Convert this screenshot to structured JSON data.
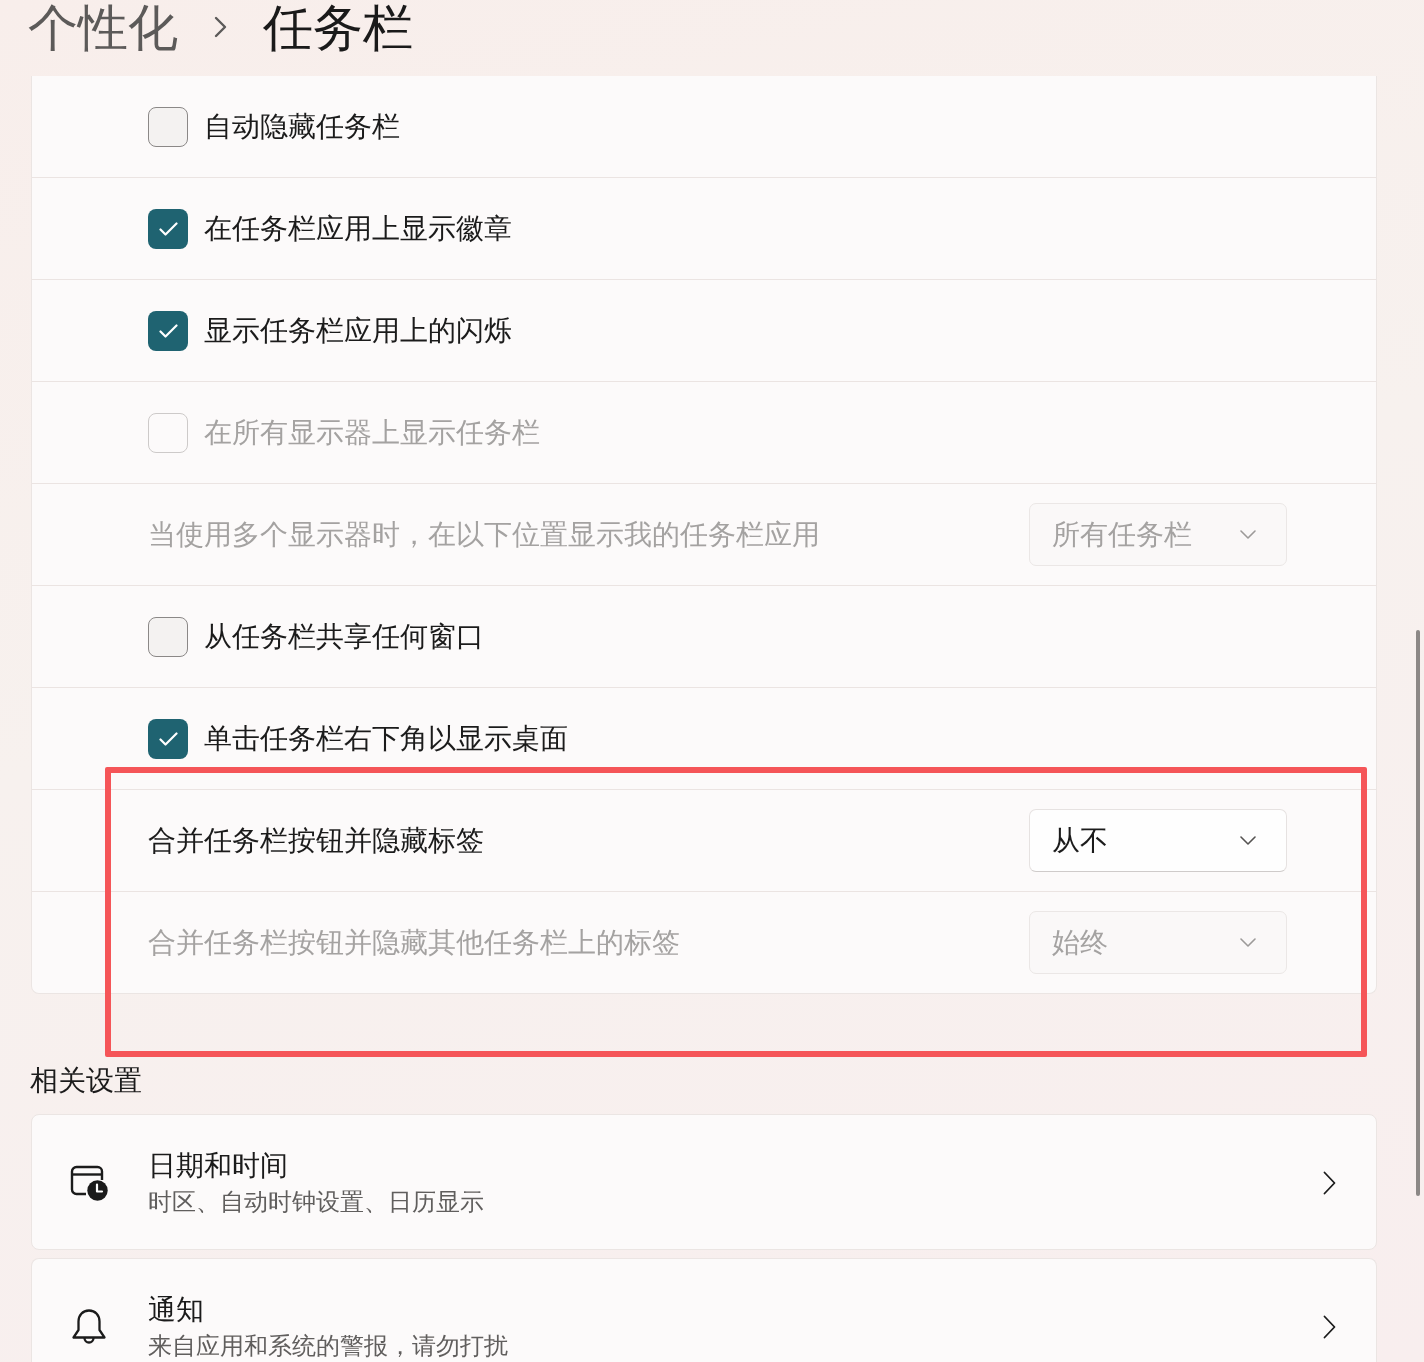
{
  "breadcrumb": {
    "parent": "个性化",
    "current": "任务栏"
  },
  "taskbar_behaviors": {
    "rows": [
      {
        "kind": "checkbox",
        "label": "自动隐藏任务栏",
        "checked": false,
        "disabled": false
      },
      {
        "kind": "checkbox",
        "label": "在任务栏应用上显示徽章",
        "checked": true,
        "disabled": false
      },
      {
        "kind": "checkbox",
        "label": "显示任务栏应用上的闪烁",
        "checked": true,
        "disabled": false
      },
      {
        "kind": "checkbox",
        "label": "在所有显示器上显示任务栏",
        "checked": false,
        "disabled": true
      },
      {
        "kind": "dropdown",
        "label": "当使用多个显示器时，在以下位置显示我的任务栏应用",
        "value": "所有任务栏",
        "disabled": true
      },
      {
        "kind": "checkbox",
        "label": "从任务栏共享任何窗口",
        "checked": false,
        "disabled": false
      },
      {
        "kind": "checkbox",
        "label": "单击任务栏右下角以显示桌面",
        "checked": true,
        "disabled": false
      },
      {
        "kind": "dropdown",
        "label": "合并任务栏按钮并隐藏标签",
        "value": "从不",
        "disabled": false
      },
      {
        "kind": "dropdown",
        "label": "合并任务栏按钮并隐藏其他任务栏上的标签",
        "value": "始终",
        "disabled": true
      }
    ]
  },
  "related_settings": {
    "title": "相关设置",
    "items": [
      {
        "kind": "date-time",
        "title": "日期和时间",
        "subtitle": "时区、自动时钟设置、日历显示"
      },
      {
        "kind": "notifications",
        "title": "通知",
        "subtitle": "来自应用和系统的警报，请勿打扰"
      }
    ]
  }
}
